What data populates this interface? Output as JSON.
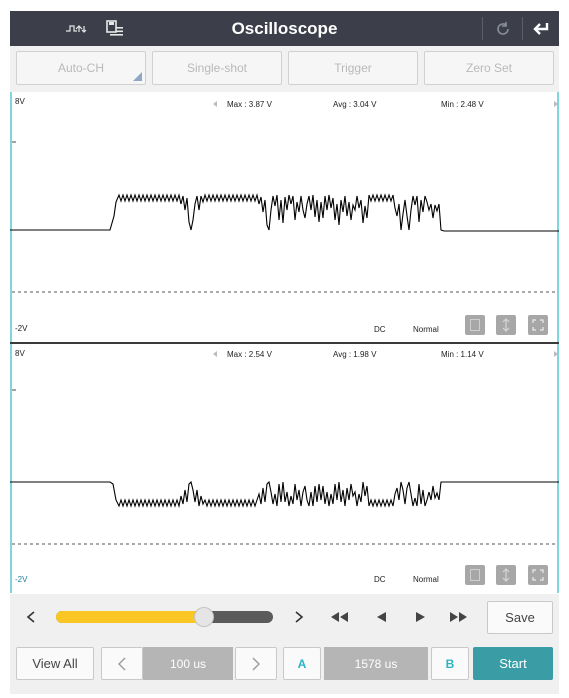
{
  "app": {
    "title": "Oscilloscope",
    "icons": [
      "pulse-toggle-icon",
      "save-table-icon",
      "refresh-icon",
      "back-arrow-icon"
    ]
  },
  "toolbar": {
    "auto_ch": "Auto-CH",
    "single_shot": "Single-shot",
    "trigger": "Trigger",
    "zero_set": "Zero Set"
  },
  "channels": [
    {
      "vmax_label": "8V",
      "vmin_label": "-2V",
      "max": "Max : 3.87 V",
      "avg": "Avg : 3.04 V",
      "min": "Min : 2.48 V",
      "coupling": "DC",
      "mode": "Normal",
      "trace_color": "#000000"
    },
    {
      "vmax_label": "8V",
      "vmin_label": "-2V",
      "max": "Max : 2.54 V",
      "avg": "Avg : 1.98 V",
      "min": "Min : 1.14 V",
      "coupling": "DC",
      "mode": "Normal",
      "trace_color": "#000000"
    }
  ],
  "controls": {
    "slider_value": 0.7,
    "slider_color": "#f9c623",
    "save": "Save",
    "view_all": "View All",
    "timebase": "100 us",
    "cursor_a": "A",
    "cursor_delta": "1578 us",
    "cursor_b": "B",
    "start": "Start",
    "accent": "#3a9da6"
  }
}
